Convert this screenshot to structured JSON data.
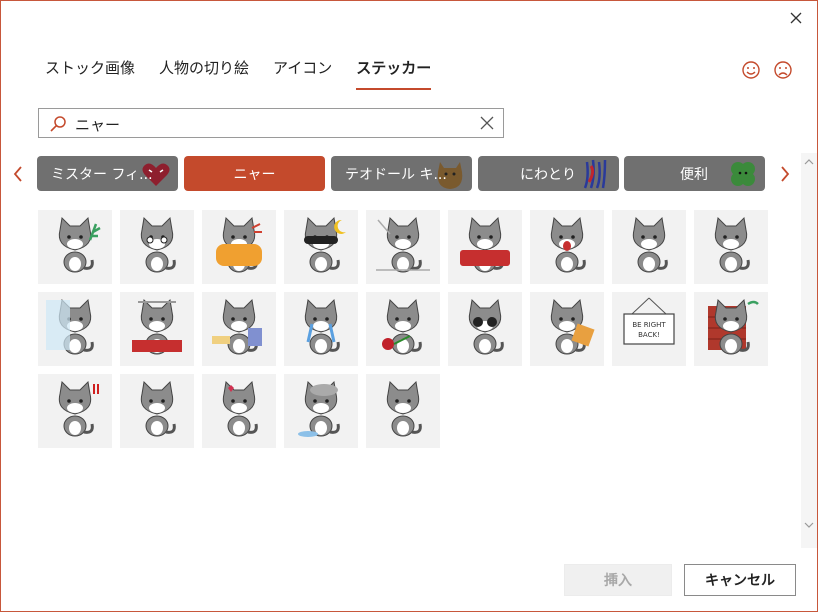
{
  "dialog": {
    "close_icon": "close-icon"
  },
  "tabs": [
    {
      "label": "ストック画像",
      "active": false
    },
    {
      "label": "人物の切り絵",
      "active": false
    },
    {
      "label": "アイコン",
      "active": false
    },
    {
      "label": "ステッカー",
      "active": true
    }
  ],
  "feedback": {
    "happy_icon": "smile-icon",
    "sad_icon": "frown-icon"
  },
  "search": {
    "value": "ニャー",
    "icon": "search-icon",
    "clear_icon": "clear-icon"
  },
  "categories": [
    {
      "label": "ミスター フィ...",
      "active": false,
      "deco": "heart"
    },
    {
      "label": "ニャー",
      "active": true,
      "deco": ""
    },
    {
      "label": "テオドール キ...",
      "active": false,
      "deco": "creature"
    },
    {
      "label": "にわとり",
      "active": false,
      "deco": "splat"
    },
    {
      "label": "便利",
      "active": false,
      "deco": "clover"
    }
  ],
  "stickers": [
    {
      "prop": "plant"
    },
    {
      "prop": "teary"
    },
    {
      "prop": "blanket"
    },
    {
      "prop": "sleepmask"
    },
    {
      "prop": "stretch"
    },
    {
      "prop": "bed"
    },
    {
      "prop": "shout"
    },
    {
      "prop": "sit"
    },
    {
      "prop": "wave"
    },
    {
      "prop": "shower"
    },
    {
      "prop": "lazy"
    },
    {
      "prop": "books"
    },
    {
      "prop": "cry"
    },
    {
      "prop": "rose"
    },
    {
      "prop": "bigeyes"
    },
    {
      "prop": "box"
    },
    {
      "prop": "sign"
    },
    {
      "prop": "wall"
    },
    {
      "prop": "angry"
    },
    {
      "prop": "happy"
    },
    {
      "prop": "love"
    },
    {
      "prop": "cloud"
    },
    {
      "prop": "walk"
    }
  ],
  "sticker_sign_text": "BE RIGHT BACK!",
  "buttons": {
    "insert_label": "挿入",
    "insert_enabled": false,
    "cancel_label": "キャンセル"
  }
}
